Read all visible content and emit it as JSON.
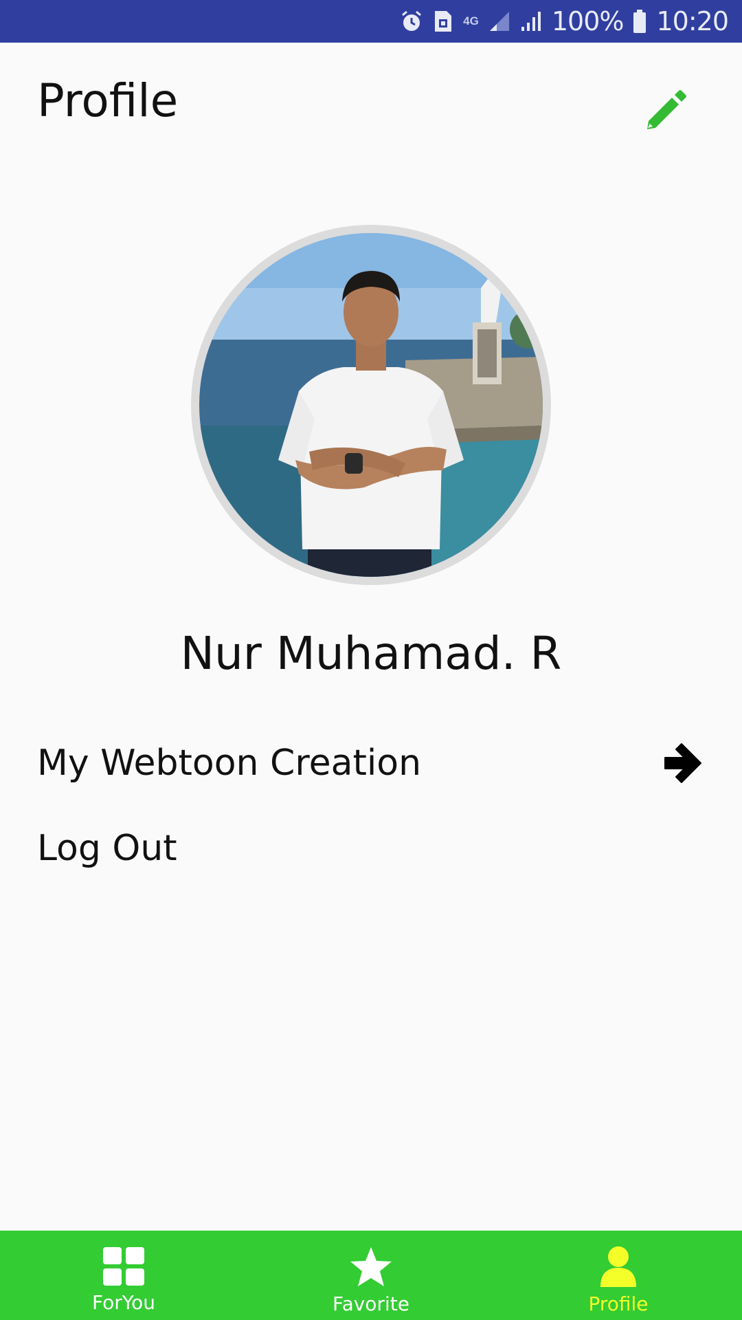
{
  "status_bar": {
    "network_label": "4G",
    "battery": "100%",
    "time": "10:20",
    "icons": [
      "alarm-icon",
      "sim-card-icon",
      "network-4g-icon",
      "signal-icon",
      "signal-icon",
      "battery-icon"
    ]
  },
  "header": {
    "title": "Profile",
    "edit_icon": "pencil-icon"
  },
  "profile": {
    "name": "Nur Muhamad. R",
    "avatar_icon": "profile-photo"
  },
  "menu": {
    "items": [
      {
        "label": "My Webtoon Creation",
        "icon": "arrow-right-icon"
      },
      {
        "label": "Log Out"
      }
    ]
  },
  "bottom_nav": {
    "items": [
      {
        "label": "ForYou",
        "icon": "grid-icon",
        "active": false
      },
      {
        "label": "Favorite",
        "icon": "star-icon",
        "active": false
      },
      {
        "label": "Profile",
        "icon": "person-icon",
        "active": true
      }
    ]
  },
  "colors": {
    "status_bar": "#303f9f",
    "accent_green": "#33cc33",
    "active_nav": "#f4ff2a",
    "background": "#fafafa"
  }
}
